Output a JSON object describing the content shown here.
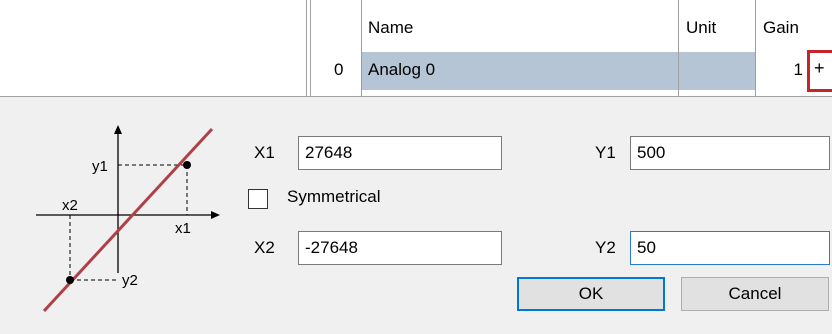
{
  "table": {
    "headers": {
      "name": "Name",
      "unit": "Unit",
      "gain": "Gain"
    },
    "row": {
      "index": "0",
      "name": "Analog 0",
      "unit": "",
      "gain": "1"
    },
    "edit_icon": "ellipsis-icon",
    "edit_glyph": "+"
  },
  "dialog": {
    "diagram": {
      "labels": {
        "x1": "x1",
        "x2": "x2",
        "y1": "y1",
        "y2": "y2"
      },
      "line_color": "#b04048"
    },
    "x1_label": "X1",
    "x1_value": "27648",
    "y1_label": "Y1",
    "y1_value": "500",
    "symmetrical_label": "Symmetrical",
    "symmetrical_checked": false,
    "x2_label": "X2",
    "x2_value": "-27648",
    "y2_label": "Y2",
    "y2_value": "50",
    "ok_label": "OK",
    "cancel_label": "Cancel"
  },
  "colors": {
    "selected_row": "#b5c5d6",
    "highlight_border": "#c4242b",
    "focus_border": "#2a7ad5"
  }
}
